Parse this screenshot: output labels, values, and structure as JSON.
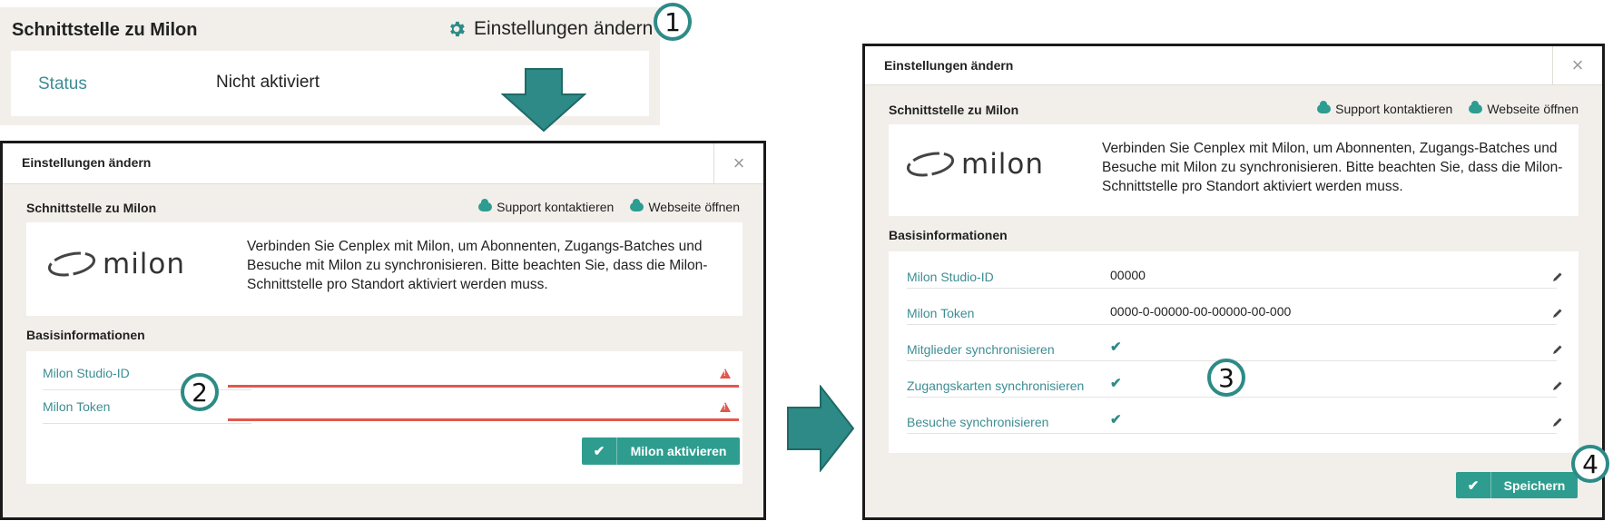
{
  "status_card": {
    "title": "Schnittstelle zu Milon",
    "settings_link": "Einstellungen ändern",
    "status_label": "Status",
    "status_value": "Nicht aktiviert"
  },
  "callouts": {
    "c1": "1",
    "c2": "2",
    "c3": "3",
    "c4": "4"
  },
  "modal_left": {
    "title": "Einstellungen ändern",
    "close": "×",
    "section_title": "Schnittstelle zu Milon",
    "support_link": "Support kontaktieren",
    "website_link": "Webseite öffnen",
    "logo_text": "milon",
    "description": "Verbinden Sie Cenplex mit Milon, um Abonnenten, Zugangs-Batches und Besuche mit Milon zu synchronisieren. Bitte beachten Sie, dass die Milon-Schnittstelle pro Standort aktiviert werden muss.",
    "basis_title": "Basisinformationen",
    "fields": [
      {
        "label": "Milon Studio-ID",
        "value": ""
      },
      {
        "label": "Milon Token",
        "value": ""
      }
    ],
    "activate_button": "Milon aktivieren"
  },
  "modal_right": {
    "title": "Einstellungen ändern",
    "close": "×",
    "section_title": "Schnittstelle zu Milon",
    "support_link": "Support kontaktieren",
    "website_link": "Webseite öffnen",
    "logo_text": "milon",
    "description": "Verbinden Sie Cenplex mit Milon, um Abonnenten, Zugangs-Batches und Besuche mit Milon zu synchronisieren. Bitte beachten Sie, dass die Milon-Schnittstelle pro Standort aktiviert werden muss.",
    "basis_title": "Basisinformationen",
    "fields": [
      {
        "label": "Milon Studio-ID",
        "value": "00000"
      },
      {
        "label": "Milon Token",
        "value": "0000-0-00000-00-00000-00-000"
      },
      {
        "label": "Mitglieder synchronisieren",
        "value": ""
      },
      {
        "label": "Zugangskarten synchronisieren",
        "value": ""
      },
      {
        "label": "Besuche synchronisieren",
        "value": ""
      }
    ],
    "save_button": "Speichern"
  },
  "colors": {
    "accent": "#2e9d8f",
    "error": "#e0584c",
    "label": "#3d8d93",
    "panel": "#f2efeb"
  }
}
